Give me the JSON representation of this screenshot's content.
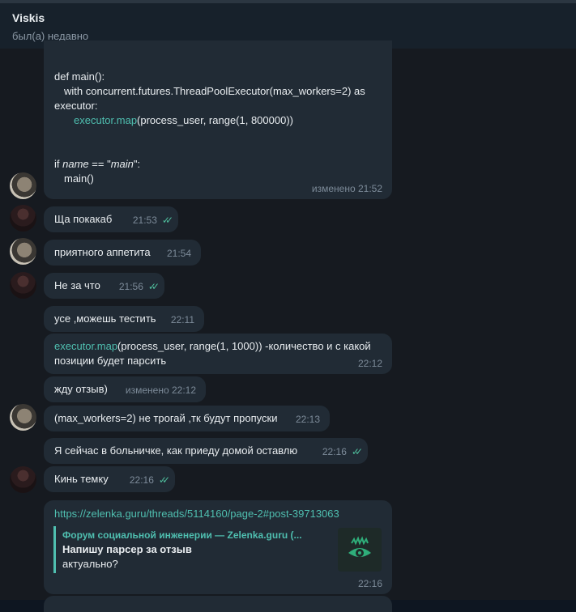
{
  "header": {
    "title": "Viskis",
    "status": "был(а) недавно"
  },
  "messages": {
    "code": {
      "line1": "def main():",
      "line2": "with concurrent.futures.ThreadPoolExecutor(max_workers=2) as",
      "line3": "executor:",
      "line4_link": "executor.map",
      "line4_rest": "(process_user, range(1, 800000))",
      "line5a": "if ",
      "line5b": "name",
      "line5c": " == \"",
      "line5d": "main",
      "line5e": "\":",
      "line6": "main()",
      "meta": "изменено 21:52"
    },
    "m1": {
      "text": "Ща покакаб",
      "time": "21:53"
    },
    "m2": {
      "text": "приятного аппетита",
      "time": "21:54"
    },
    "m3": {
      "text": "Не за что",
      "time": "21:56"
    },
    "m4": {
      "text": "усе ,можешь тестить",
      "time": "22:11"
    },
    "m5": {
      "link": "executor.map",
      "rest": "(process_user, range(1, 1000)) -количество и с какой",
      "line2": "позиции будет парсить",
      "time": "22:12"
    },
    "m6": {
      "text": "жду отзыв)",
      "meta": "изменено 22:12"
    },
    "m7": {
      "text": "(max_workers=2) не трогай ,тк будут пропуски",
      "time": "22:13"
    },
    "m8": {
      "text": "Я сейчас в больничке, как приеду домой оставлю",
      "time": "22:16"
    },
    "m9": {
      "text": "Кинь темку",
      "time": "22:16"
    },
    "m10": {
      "url": "https://zelenka.guru/threads/5114160/page-2#post-39713063",
      "site": "Форум социальной инженерии — Zelenka.guru (...",
      "title": "Напишу парсер за отзыв",
      "desc": "актуально?",
      "time": "22:16"
    }
  },
  "checks_glyph": "✓✓",
  "colors": {
    "accent": "#4fbfb0",
    "bubble": "#212b35",
    "background": "#161a20"
  }
}
